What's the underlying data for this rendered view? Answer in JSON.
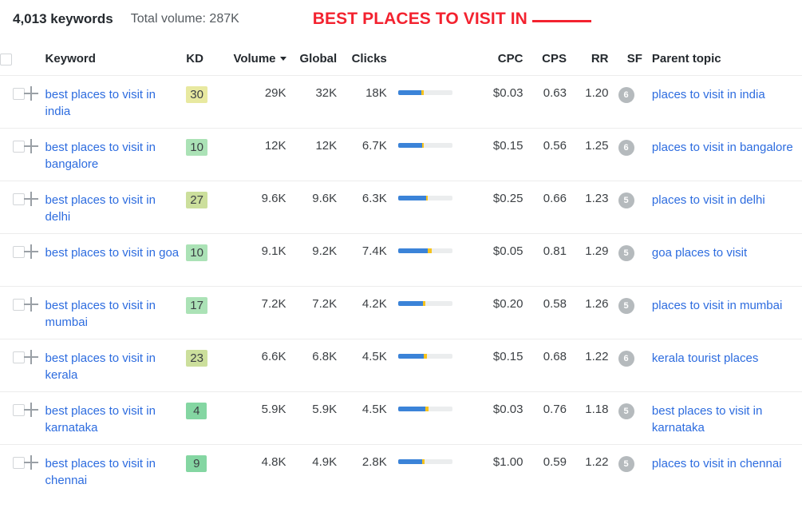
{
  "summary": {
    "keyword_count": "4,013 keywords",
    "total_volume": "Total volume: 287K"
  },
  "overlay_title": {
    "text": "BEST PLACES TO VISIT IN",
    "color": "#f3222f"
  },
  "table": {
    "headers": {
      "keyword": "Keyword",
      "kd": "KD",
      "volume": "Volume",
      "global": "Global",
      "clicks": "Clicks",
      "cpc": "CPC",
      "cps": "CPS",
      "rr": "RR",
      "sf": "SF",
      "parent_topic": "Parent topic"
    },
    "sorted_by": "volume",
    "sort_direction": "desc",
    "rows": [
      {
        "keyword": "best places to visit in india",
        "kd": "30",
        "kd_color": "#e8e9a0",
        "volume": "29K",
        "global": "32K",
        "clicks": "18K",
        "bar_blue_pct": 43,
        "bar_accent_pct": 4,
        "cpc": "$0.03",
        "cps": "0.63",
        "rr": "1.20",
        "sf": "6",
        "parent_topic": "places to visit in india"
      },
      {
        "keyword": "best places to visit in bangalore",
        "kd": "10",
        "kd_color": "#abe2b6",
        "volume": "12K",
        "global": "12K",
        "clicks": "6.7K",
        "bar_blue_pct": 44,
        "bar_accent_pct": 4,
        "cpc": "$0.15",
        "cps": "0.56",
        "rr": "1.25",
        "sf": "6",
        "parent_topic": "places to visit in bangalore"
      },
      {
        "keyword": "best places to visit in delhi",
        "kd": "27",
        "kd_color": "#ccdf9c",
        "volume": "9.6K",
        "global": "9.6K",
        "clicks": "6.3K",
        "bar_blue_pct": 52,
        "bar_accent_pct": 3,
        "cpc": "$0.25",
        "cps": "0.66",
        "rr": "1.23",
        "sf": "5",
        "parent_topic": "places to visit in delhi"
      },
      {
        "keyword": "best places to visit in goa",
        "kd": "10",
        "kd_color": "#abe2b6",
        "volume": "9.1K",
        "global": "9.2K",
        "clicks": "7.4K",
        "bar_blue_pct": 55,
        "bar_accent_pct": 7,
        "cpc": "$0.05",
        "cps": "0.81",
        "rr": "1.29",
        "sf": "5",
        "parent_topic": "goa places to visit"
      },
      {
        "keyword": "best places to visit in mumbai",
        "kd": "17",
        "kd_color": "#abe2b6",
        "volume": "7.2K",
        "global": "7.2K",
        "clicks": "4.2K",
        "bar_blue_pct": 46,
        "bar_accent_pct": 4,
        "cpc": "$0.20",
        "cps": "0.58",
        "rr": "1.26",
        "sf": "5",
        "parent_topic": "places to visit in mumbai"
      },
      {
        "keyword": "best places to visit in kerala",
        "kd": "23",
        "kd_color": "#ccdf9c",
        "volume": "6.6K",
        "global": "6.8K",
        "clicks": "4.5K",
        "bar_blue_pct": 48,
        "bar_accent_pct": 5,
        "cpc": "$0.15",
        "cps": "0.68",
        "rr": "1.22",
        "sf": "6",
        "parent_topic": "kerala tourist places"
      },
      {
        "keyword": "best places to visit in karnataka",
        "kd": "4",
        "kd_color": "#84d6a2",
        "volume": "5.9K",
        "global": "5.9K",
        "clicks": "4.5K",
        "bar_blue_pct": 51,
        "bar_accent_pct": 5,
        "cpc": "$0.03",
        "cps": "0.76",
        "rr": "1.18",
        "sf": "5",
        "parent_topic": "best places to visit in karnataka"
      },
      {
        "keyword": "best places to visit in chennai",
        "kd": "9",
        "kd_color": "#84d6a2",
        "volume": "4.8K",
        "global": "4.9K",
        "clicks": "2.8K",
        "bar_blue_pct": 45,
        "bar_accent_pct": 4,
        "cpc": "$1.00",
        "cps": "0.59",
        "rr": "1.22",
        "sf": "5",
        "parent_topic": "places to visit in chennai"
      }
    ]
  }
}
